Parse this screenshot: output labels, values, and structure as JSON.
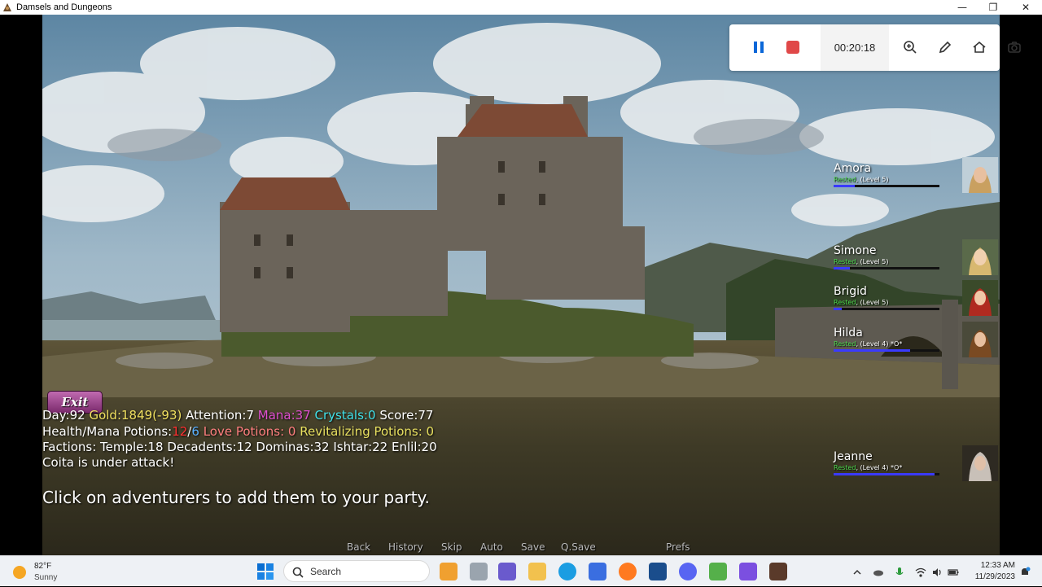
{
  "window": {
    "title": "Damsels and Dungeons",
    "minimize_glyph": "—",
    "maximize_glyph": "❐",
    "close_glyph": "✕"
  },
  "recorder": {
    "elapsed": "00:20:18",
    "pause_icon": "pause-icon",
    "stop_icon": "stop-icon",
    "accent_color": "#0b67d8",
    "stop_color": "#e04848"
  },
  "party": [
    {
      "name": "Amora",
      "status_label": "Rested",
      "status_rest": ", (Level 5)",
      "health_fraction": 0.2
    },
    {
      "name": "Simone",
      "status_label": "Rested",
      "status_rest": ", (Level 5)",
      "health_fraction": 0.15
    },
    {
      "name": "Brigid",
      "status_label": "Rested",
      "status_rest": ", (Level 5)",
      "health_fraction": 0.08
    },
    {
      "name": "Hilda",
      "status_label": "Rested",
      "status_rest": ", (Level 4) *O*",
      "health_fraction": 0.72
    },
    {
      "name": "Jeanne",
      "status_label": "Rested",
      "status_rest": ", (Level 4) *O*",
      "health_fraction": 0.95
    }
  ],
  "exit_label": "Exit",
  "hud": {
    "day": "Day:92",
    "gold": "Gold:1849(-93)",
    "attention": "Attention:7",
    "mana": "Mana:37",
    "crystals": "Crystals:0",
    "score": "Score:77",
    "health_mana_label": "Health/Mana Potions:",
    "health_potions": "12",
    "potion_sep": "/",
    "mana_potions": "6",
    "love_potions": "Love Potions: 0",
    "revitalizing_potions": "Revitalizing Potions: 0",
    "factions": "Factions: Temple:18 Decadents:12 Dominas:32 Ishtar:22 Enlil:20",
    "alert": "Coita is under attack!"
  },
  "instruction": "Click on adventurers to add them to your party.",
  "quick_menu": [
    "Back",
    "History",
    "Skip",
    "Auto",
    "Save",
    "Q.Save",
    "Prefs"
  ],
  "taskbar": {
    "temperature": "82°F",
    "condition": "Sunny",
    "search_label": "Search",
    "time": "12:33 AM",
    "date": "11/29/2023"
  }
}
